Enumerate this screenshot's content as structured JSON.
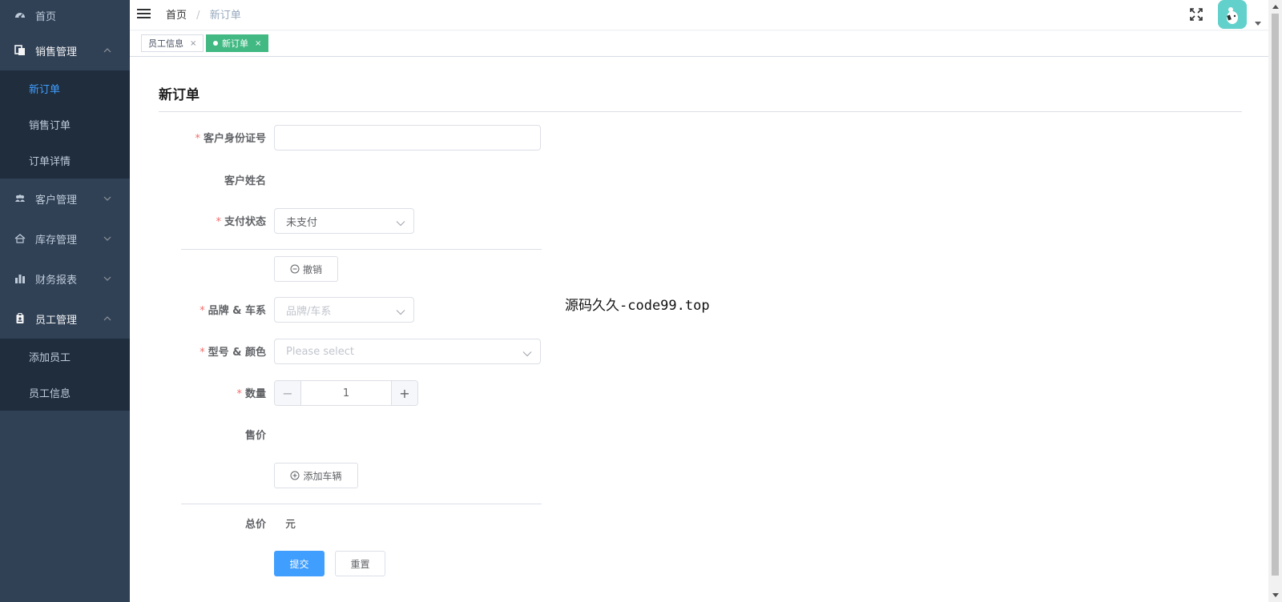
{
  "colors": {
    "sidebar_bg": "#304156",
    "submenu_bg": "#1f2d3d",
    "sidebar_text": "#bfcbd9",
    "active_link": "#409eff",
    "active_tag": "#42b983",
    "required": "#f56c6c",
    "primary": "#409eff"
  },
  "sidebar": {
    "home": {
      "label": "首页",
      "icon": "dashboard-icon"
    },
    "sales": {
      "label": "销售管理",
      "icon": "documents-icon",
      "expanded": true,
      "items": [
        {
          "label": "新订单",
          "active": true
        },
        {
          "label": "销售订单"
        },
        {
          "label": "订单详情"
        }
      ]
    },
    "customer": {
      "label": "客户管理",
      "icon": "people-icon"
    },
    "inventory": {
      "label": "库存管理",
      "icon": "warehouse-icon"
    },
    "finance": {
      "label": "财务报表",
      "icon": "bar-chart-icon"
    },
    "staff": {
      "label": "员工管理",
      "icon": "badge-icon",
      "expanded": true,
      "items": [
        {
          "label": "添加员工"
        },
        {
          "label": "员工信息"
        }
      ]
    }
  },
  "navbar": {
    "breadcrumb": {
      "home": "首页",
      "separator": "/",
      "current": "新订单"
    }
  },
  "tags": [
    {
      "label": "员工信息",
      "close": "×",
      "active": false
    },
    {
      "label": "新订单",
      "close": "×",
      "active": true
    }
  ],
  "form": {
    "title": "新订单",
    "id_card": {
      "label": "客户身份证号",
      "value": ""
    },
    "customer_name": {
      "label": "客户姓名",
      "value": ""
    },
    "pay_status": {
      "label": "支付状态",
      "value": "未支付"
    },
    "cancel_button": "撤销",
    "brand_series": {
      "label": "品牌 & 车系",
      "placeholder": "品牌/车系"
    },
    "model_color": {
      "label": "型号 & 颜色",
      "placeholder": "Please select"
    },
    "quantity": {
      "label": "数量",
      "value": "1",
      "minus": "−",
      "plus": "+"
    },
    "sale_price": {
      "label": "售价",
      "value": ""
    },
    "add_vehicle_button": "添加车辆",
    "total": {
      "label": "总价",
      "unit": "元"
    },
    "submit_button": "提交",
    "reset_button": "重置",
    "required_mark": "*"
  },
  "watermark": "源码久久-code99.top"
}
